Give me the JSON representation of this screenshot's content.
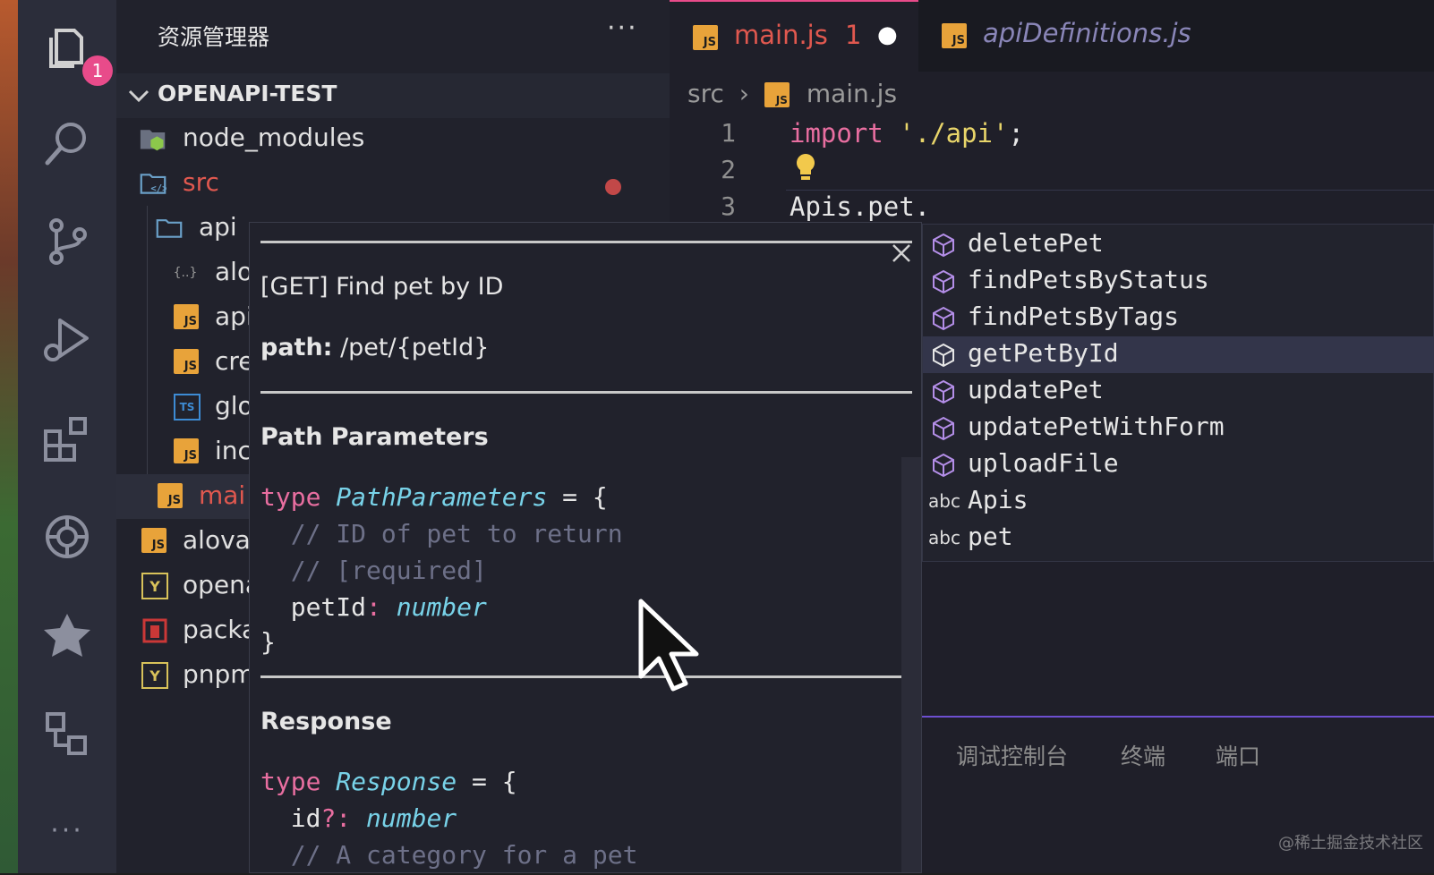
{
  "sidebar": {
    "title": "资源管理器",
    "more": "···",
    "project": "OPENAPI-TEST",
    "badge_count": "1",
    "items": [
      {
        "label": "node_modules",
        "icon": "node-folder-icon"
      },
      {
        "label": "src",
        "icon": "src-folder-icon"
      },
      {
        "label": "api",
        "icon": "folder-icon"
      },
      {
        "label": "alo",
        "icon": "json-braces-icon"
      },
      {
        "label": "api",
        "icon": "js-file-icon"
      },
      {
        "label": "cre",
        "icon": "js-file-icon"
      },
      {
        "label": "glo",
        "icon": "ts-file-icon"
      },
      {
        "label": "inc",
        "icon": "js-file-icon"
      },
      {
        "label": "mai",
        "icon": "js-file-icon"
      },
      {
        "label": "alova",
        "icon": "js-file-icon"
      },
      {
        "label": "opena",
        "icon": "yaml-file-icon"
      },
      {
        "label": "packa",
        "icon": "npm-file-icon"
      },
      {
        "label": "pnpm",
        "icon": "yaml-file-icon"
      }
    ]
  },
  "tabs": [
    {
      "label": "main.js",
      "problems": "1",
      "dirty": "●"
    },
    {
      "label": "apiDefinitions.js"
    }
  ],
  "breadcrumb": {
    "folder": "src",
    "file": "main.js",
    "sep": "›"
  },
  "js_badge": "JS",
  "ts_badge": "TS",
  "yaml_badge": "Y",
  "code": {
    "lines": [
      "1",
      "2",
      "3"
    ],
    "line1_kw": "import",
    "line1_str": "'./api'",
    "line1_end": ";",
    "line3": "Apis.pet."
  },
  "hover": {
    "title": "[GET] Find pet by ID",
    "path_label": "path:",
    "path_value": " /pet/{petId}",
    "section1": "Path Parameters",
    "type_kw": "type",
    "type1_name": "PathParameters",
    "eq": " = {",
    "comment1": "  // ID of pet to return",
    "comment2": "  // [required]",
    "field1": "  petId",
    "field1_colon": ": ",
    "field1_type": "number",
    "close_brace": "}",
    "section2": "Response",
    "type2_name": "Response",
    "field2": "  id",
    "field2_colon": "?: ",
    "field2_type": "number",
    "comment3": "  // A category for a pet"
  },
  "suggestions": [
    {
      "label": "deletePet",
      "kind": "method"
    },
    {
      "label": "findPetsByStatus",
      "kind": "method"
    },
    {
      "label": "findPetsByTags",
      "kind": "method"
    },
    {
      "label": "getPetById",
      "kind": "method"
    },
    {
      "label": "updatePet",
      "kind": "method"
    },
    {
      "label": "updatePetWithForm",
      "kind": "method"
    },
    {
      "label": "uploadFile",
      "kind": "method"
    },
    {
      "label": "Apis",
      "kind": "abc"
    },
    {
      "label": "pet",
      "kind": "abc"
    }
  ],
  "abc": "abc",
  "panel_tabs": [
    "调试控制台",
    "终端",
    "端口"
  ],
  "watermark": "@稀土掘金技术社区",
  "colors": {
    "accent": "#e84b8a",
    "keyword": "#e86ea0",
    "string": "#e8d56a",
    "type": "#78d2e8",
    "comment": "#6d7088"
  }
}
